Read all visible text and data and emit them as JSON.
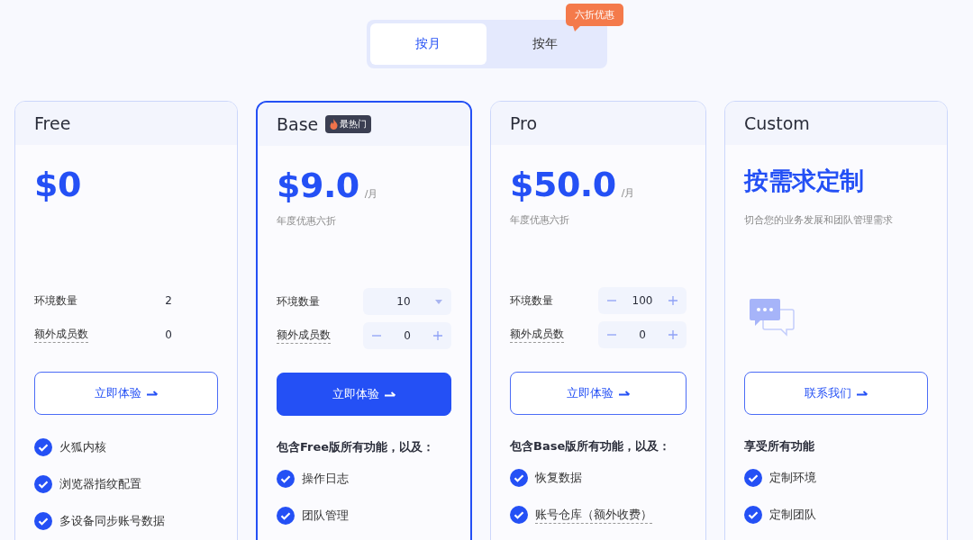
{
  "billing_toggle": {
    "tabs": [
      {
        "label": "按月",
        "selected": true
      },
      {
        "label": "按年",
        "selected": false
      }
    ],
    "badge": "六折优惠"
  },
  "plans": [
    {
      "kind": "standard",
      "name": "Free",
      "highlighted": false,
      "price": "$0",
      "params": [
        {
          "label": "环境数量",
          "has_tooltip": false,
          "kind": "plain",
          "value": "2"
        },
        {
          "label": "额外成员数",
          "has_tooltip": true,
          "kind": "plain",
          "value": "0"
        }
      ],
      "button": {
        "label": "立即体验",
        "primary": false
      },
      "features": [
        {
          "label": "火狐内核",
          "has_tooltip": false
        },
        {
          "label": "浏览器指纹配置",
          "has_tooltip": false
        },
        {
          "label": "多设备同步账号数据",
          "has_tooltip": false
        }
      ]
    },
    {
      "kind": "standard",
      "name": "Base",
      "tag": "最热门",
      "highlighted": true,
      "price": "$9.0",
      "unit": "/月",
      "subtitle": "年度优惠六折",
      "params": [
        {
          "label": "环境数量",
          "has_tooltip": false,
          "kind": "select",
          "value": "10"
        },
        {
          "label": "额外成员数",
          "has_tooltip": true,
          "kind": "stepper",
          "value": "0"
        }
      ],
      "button": {
        "label": "立即体验",
        "primary": true
      },
      "features_heading": "包含Free版所有功能，以及：",
      "features": [
        {
          "label": "操作日志",
          "has_tooltip": false
        },
        {
          "label": "团队管理",
          "has_tooltip": false
        }
      ]
    },
    {
      "kind": "standard",
      "name": "Pro",
      "highlighted": false,
      "price": "$50.0",
      "unit": "/月",
      "subtitle": "年度优惠六折",
      "params": [
        {
          "label": "环境数量",
          "has_tooltip": false,
          "kind": "stepper",
          "value": "100"
        },
        {
          "label": "额外成员数",
          "has_tooltip": true,
          "kind": "stepper",
          "value": "0"
        }
      ],
      "button": {
        "label": "立即体验",
        "primary": false
      },
      "features_heading": "包含Base版所有功能，以及：",
      "features": [
        {
          "label": "恢复数据",
          "has_tooltip": false
        },
        {
          "label": "账号仓库（额外收费）",
          "has_tooltip": true
        }
      ]
    },
    {
      "kind": "custom",
      "name": "Custom",
      "highlighted": false,
      "price": "按需求定制",
      "subtitle": "切合您的业务发展和团队管理需求",
      "button": {
        "label": "联系我们",
        "primary": false
      },
      "features_heading": "享受所有功能",
      "features": [
        {
          "label": "定制环境",
          "has_tooltip": false
        },
        {
          "label": "定制团队",
          "has_tooltip": false
        }
      ]
    }
  ]
}
